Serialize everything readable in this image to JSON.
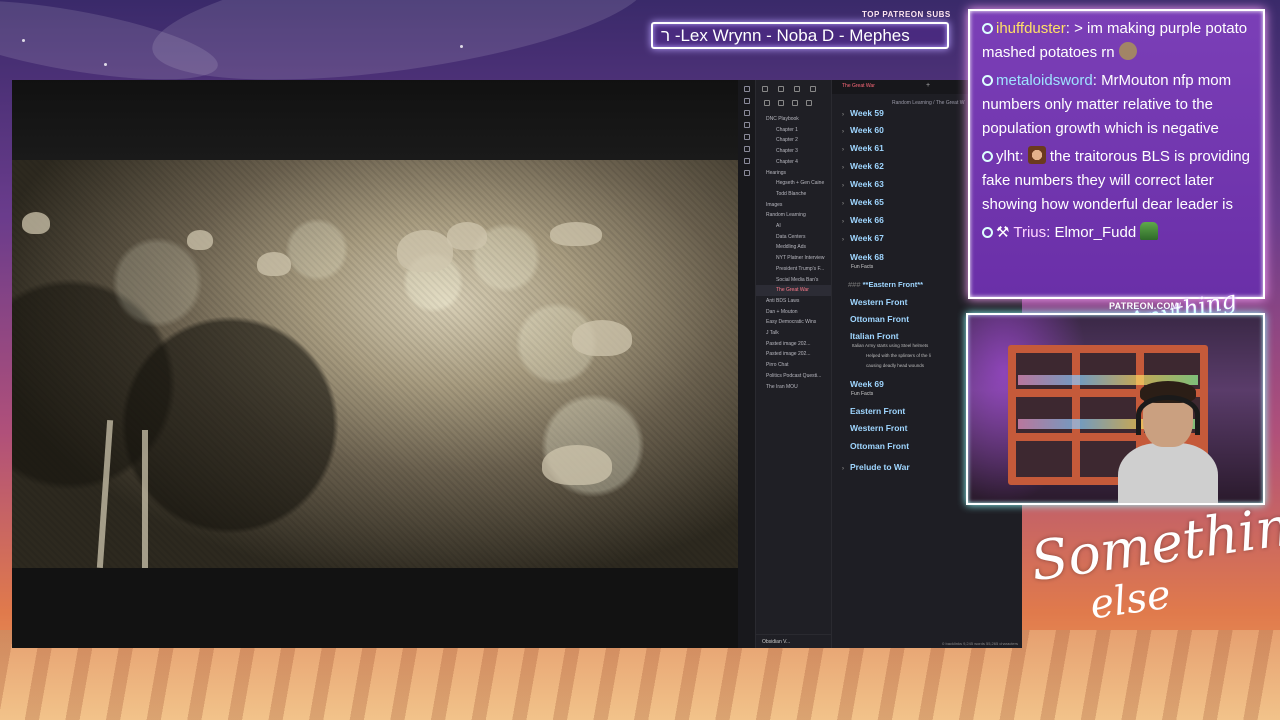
{
  "patreon": {
    "label": "TOP PATREON SUBS",
    "names": "ר -Lex Wrynn -  Noba D - Mephes"
  },
  "obsidian": {
    "tab_title": "The Great War",
    "breadcrumb": "Random Learning  /  The Great W",
    "tree": [
      {
        "label": "DNC Playbook"
      },
      {
        "label": "Chapter 1"
      },
      {
        "label": "Chapter 2"
      },
      {
        "label": "Chapter 3"
      },
      {
        "label": "Chapter 4"
      },
      {
        "label": "Hearings"
      },
      {
        "label": "Hegseth + Gen Caine"
      },
      {
        "label": "Todd Blanche"
      },
      {
        "label": "Images"
      },
      {
        "label": "Random Learning"
      },
      {
        "label": "AI"
      },
      {
        "label": "Data Centers"
      },
      {
        "label": "Meddling Ads"
      },
      {
        "label": "NYT Platner Interview"
      },
      {
        "label": "President Trump's F..."
      },
      {
        "label": "Social Media Ban's"
      },
      {
        "label": "The Great War"
      },
      {
        "label": "Anti BDS Laws"
      },
      {
        "label": "Dan + Mouton"
      },
      {
        "label": "Easy Democratic Wins"
      },
      {
        "label": "J Talk"
      },
      {
        "label": "Pasted image 202..."
      },
      {
        "label": "Pasted image 202..."
      },
      {
        "label": "Pirro Chat"
      },
      {
        "label": "Politics Podcast Questi..."
      },
      {
        "label": "The Iran MOU"
      }
    ],
    "vault_name": "Obsidian V...",
    "weeks": {
      "w59": "Week 59",
      "w60": "Week 60",
      "w61": "Week 61",
      "w62": "Week 62",
      "w63": "Week 63",
      "w65": "Week 65",
      "w66": "Week 66",
      "w67": "Week 67",
      "w68": "Week 68",
      "w69": "Week 69",
      "prelude": "Prelude to War"
    },
    "fun_facts": "Fun Facts",
    "heading_eastern_md": "**Eastern Front**",
    "headings": {
      "western": "Western Front",
      "ottoman": "Ottoman Front",
      "italian": "Italian Front",
      "eastern": "Eastern Front"
    },
    "italian_note_1": "Italian Army starts using Steel helmets",
    "italian_note_2": "Helped with the splinters of the li",
    "italian_note_3": "causing deadly head wounds",
    "status": "0 backlinks   9,245 words  55,265 characters"
  },
  "chat": [
    {
      "user": "ihuffduster",
      "text": "> im making purple potato mashed potatoes rn"
    },
    {
      "user": "metaloidsword",
      "text": "MrMouton nfp mom numbers only matter relative to the population growth which is negative"
    },
    {
      "user": "ylht",
      "text": "the traitorous BLS is providing fake numbers they will correct later showing how wonderful dear leader is"
    },
    {
      "user": "Trius",
      "text": "Elmor_Fudd"
    }
  ],
  "overlay": {
    "patreon_url": "PATREON.COM/",
    "anything_logo": "Anything Else",
    "logo_line_1": "Something",
    "logo_line_2": "else"
  }
}
